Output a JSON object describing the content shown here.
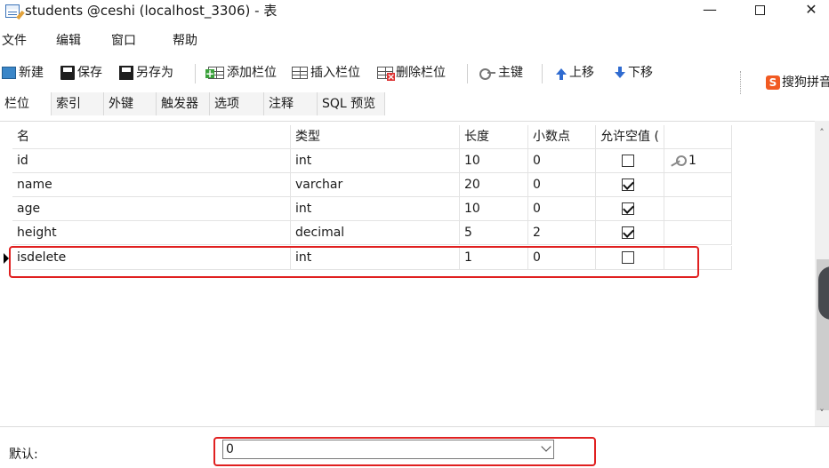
{
  "window": {
    "title": "students @ceshi (localhost_3306) - 表",
    "min_label": "—",
    "close_label": "✕"
  },
  "menu": [
    "文件",
    "编辑",
    "窗口",
    "帮助"
  ],
  "toolbar": {
    "new": "新建",
    "save": "保存",
    "save_as": "另存为",
    "add_field": "添加栏位",
    "insert_field": "插入栏位",
    "delete_field": "删除栏位",
    "primary_key": "主键",
    "move_up": "上移",
    "move_down": "下移"
  },
  "ime": {
    "logo": "S",
    "label": "搜狗拼音"
  },
  "tabs": [
    "栏位",
    "索引",
    "外键",
    "触发器",
    "选项",
    "注释",
    "SQL 预览"
  ],
  "grid": {
    "headers": [
      "名",
      "类型",
      "长度",
      "小数点",
      "允许空值 (",
      ""
    ],
    "rows": [
      {
        "name": "id",
        "type": "int",
        "length": "10",
        "decimals": "0",
        "nullable": false,
        "key": "1"
      },
      {
        "name": "name",
        "type": "varchar",
        "length": "20",
        "decimals": "0",
        "nullable": true,
        "key": ""
      },
      {
        "name": "age",
        "type": "int",
        "length": "10",
        "decimals": "0",
        "nullable": true,
        "key": ""
      },
      {
        "name": "height",
        "type": "decimal",
        "length": "5",
        "decimals": "2",
        "nullable": true,
        "key": ""
      },
      {
        "name": "isdelete",
        "type": "int",
        "length": "1",
        "decimals": "0",
        "nullable": false,
        "key": ""
      }
    ],
    "selected_row": 4
  },
  "scroll": {
    "up": "˄",
    "down": "˅"
  },
  "properties": {
    "default_label": "默认:",
    "default_value": "0"
  },
  "colors": {
    "highlight": "#e02020",
    "accent": "#2f6bd0"
  }
}
